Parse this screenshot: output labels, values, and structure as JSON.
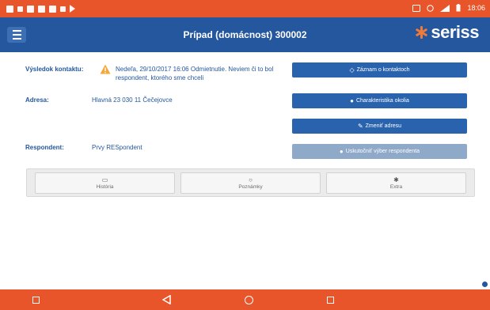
{
  "status_bar": {
    "time": "18:06",
    "left_icons": [
      "notification-icon",
      "notification-icon",
      "notification-icon",
      "notification-icon",
      "notification-icon",
      "notification-icon",
      "play-icon"
    ],
    "right_icons": [
      "cast-icon",
      "vibrate-icon",
      "wifi-icon",
      "battery-icon"
    ]
  },
  "header": {
    "title": "Prípad (domácnost) 300002",
    "logo_text": "seriss",
    "menu_icon": "hamburger-icon"
  },
  "details": {
    "contact_label": "Výsledok kontaktu:",
    "contact_value": "Nedeľa, 29/10/2017 16:06 Odmietnutie. Neviem či to bol respondent, ktorého sme chceli",
    "address_label": "Adresa:",
    "address_value": "Hlavná 23 030 11 Čečejovce",
    "respondent_label": "Respondent:",
    "respondent_value": "Prvy RESpondent"
  },
  "actions": {
    "contacts_record": "Záznam o kontaktoch",
    "neighborhood": "Charakteristika okolia",
    "change_address": "Zmeniť adresu",
    "select_respondent": "Uskutočniť výber respondenta"
  },
  "tabs": [
    {
      "label": "História",
      "icon": "calendar-icon"
    },
    {
      "label": "Poznámky",
      "icon": "speech-bubble-icon"
    },
    {
      "label": "Extra",
      "icon": "gear-icon"
    }
  ],
  "colors": {
    "status_bar": "#e8552a",
    "header": "#24579e",
    "primary_button": "#2a63ad",
    "disabled_button": "#8fa9c9",
    "accent": "#f07a3a"
  }
}
